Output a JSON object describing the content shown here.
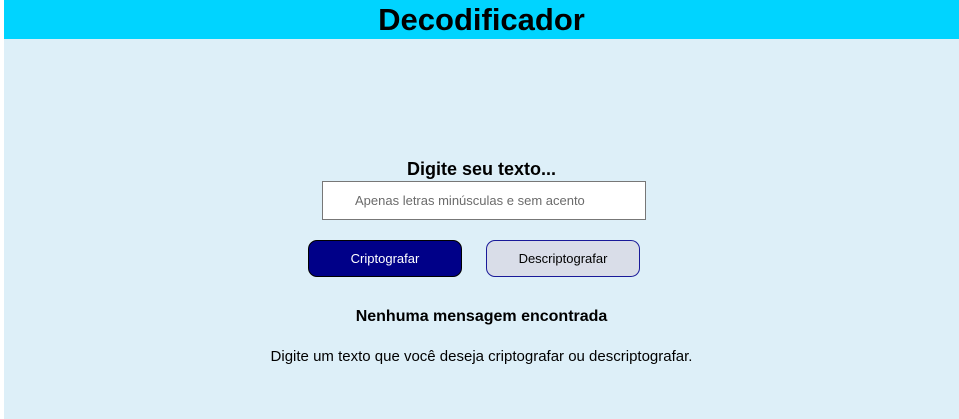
{
  "header": {
    "title": "Decodificador"
  },
  "main": {
    "prompt_label": "Digite seu texto...",
    "input": {
      "value": "",
      "placeholder": "Apenas letras minúsculas e sem acento"
    },
    "buttons": {
      "encrypt_label": "Criptografar",
      "decrypt_label": "Descriptografar"
    },
    "output": {
      "empty_title": "Nenhuma mensagem encontrada",
      "empty_description": "Digite um texto que você deseja criptografar ou descriptografar."
    }
  },
  "colors": {
    "header_bg": "#00d4ff",
    "page_bg": "#ddeff8",
    "encrypt_button_bg": "#000088",
    "decrypt_button_bg": "#d9dde8"
  }
}
